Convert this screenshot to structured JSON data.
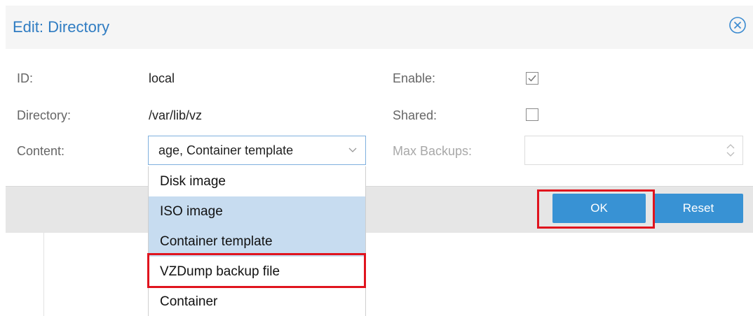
{
  "dialog": {
    "title": "Edit: Directory",
    "fields": {
      "id_label": "ID:",
      "id_value": "local",
      "directory_label": "Directory:",
      "directory_value": "/var/lib/vz",
      "content_label": "Content:",
      "content_value": "age, Container template",
      "enable_label": "Enable:",
      "enable_checked": true,
      "shared_label": "Shared:",
      "shared_checked": false,
      "max_backups_label": "Max Backups:",
      "max_backups_value": ""
    },
    "content_options": [
      {
        "label": "Disk image",
        "selected": false
      },
      {
        "label": "ISO image",
        "selected": true
      },
      {
        "label": "Container template",
        "selected": true
      },
      {
        "label": "VZDump backup file",
        "selected": false
      },
      {
        "label": "Container",
        "selected": false
      }
    ],
    "buttons": {
      "ok_label": "OK",
      "reset_label": "Reset"
    }
  },
  "colors": {
    "accent": "#3892d4",
    "title": "#2f7cc2",
    "selected_option": "#c7dcf0",
    "highlight": "#e0141e"
  },
  "icons": {
    "close": "circle-x-icon",
    "dropdown": "chevron-down-icon",
    "spinner": "spinner-arrows-icon",
    "checkbox_checked": "check-icon"
  }
}
